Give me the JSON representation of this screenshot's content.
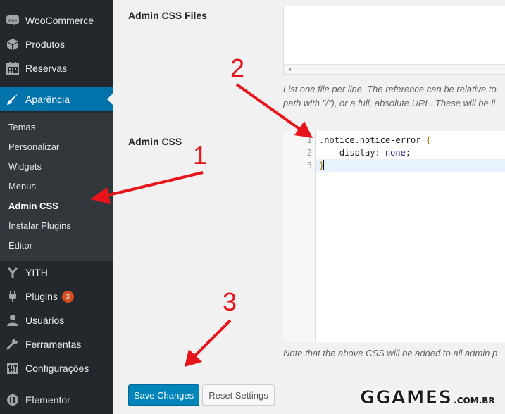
{
  "sidebar": {
    "items": [
      {
        "label": "WooCommerce",
        "icon": "woocommerce-icon"
      },
      {
        "label": "Produtos",
        "icon": "products-icon"
      },
      {
        "label": "Reservas",
        "icon": "calendar-icon"
      },
      {
        "label": "Aparência",
        "icon": "brush-icon",
        "active": true
      },
      {
        "label": "YITH",
        "icon": "yith-icon"
      },
      {
        "label": "Plugins",
        "icon": "plugin-icon",
        "badge": "3"
      },
      {
        "label": "Usuários",
        "icon": "user-icon"
      },
      {
        "label": "Ferramentas",
        "icon": "wrench-icon"
      },
      {
        "label": "Configurações",
        "icon": "settings-icon"
      },
      {
        "label": "Elementor",
        "icon": "elementor-icon"
      }
    ],
    "submenu": [
      "Temas",
      "Personalizar",
      "Widgets",
      "Menus",
      "Admin CSS",
      "Instalar Plugins",
      "Editor"
    ],
    "current_submenu": "Admin CSS",
    "active_color": "#0073aa"
  },
  "content": {
    "files_label": "Admin CSS Files",
    "files_value": "",
    "files_desc_1": "List one file per line. The reference can be relative to",
    "files_desc_2": "path with \"/\"), or a full, absolute URL. These will be li",
    "css_label": "Admin CSS",
    "code": {
      "line1_selector": ".notice.notice-error",
      "line1_brace": "{",
      "line2_prop": "display",
      "line2_val": "none",
      "line3_brace": "}"
    },
    "line_numbers": [
      "1",
      "2",
      "3"
    ],
    "css_desc": "Note that the above CSS will be added to all admin p"
  },
  "buttons": {
    "save": "Save Changes",
    "reset": "Reset Settings"
  },
  "annotations": {
    "step1": "1",
    "step2": "2",
    "step3": "3",
    "color": "#e8141b"
  },
  "watermark": {
    "main": "GGAMES",
    "sub": ".COM.BR"
  }
}
